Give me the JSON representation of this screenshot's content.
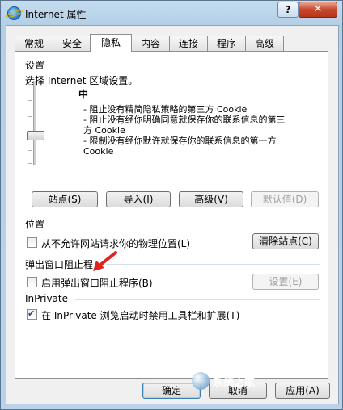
{
  "window": {
    "title": "Internet 属性",
    "help_label": "?",
    "close_label": "✕"
  },
  "tabs": [
    "常规",
    "安全",
    "隐私",
    "内容",
    "连接",
    "程序",
    "高级"
  ],
  "active_tab": "隐私",
  "settings": {
    "heading": "设置",
    "instruction": "选择 Internet 区域设置。",
    "level": "中",
    "level_position_fraction": 0.5,
    "description_lines": [
      "- 阻止没有精简隐私策略的第三方 Cookie",
      "- 阻止没有经你明确同意就保存你的联系信息的第三",
      "方 Cookie",
      "- 限制没有经你默许就保存你的联系信息的第一方",
      "Cookie"
    ],
    "buttons": {
      "sites": "站点(S)",
      "import": "导入(I)",
      "advanced": "高级(V)",
      "default": "默认值(D)"
    }
  },
  "location": {
    "heading": "位置",
    "checkbox_label": "从不允许网站请求你的物理位置(L)",
    "checked": false,
    "clear_sites": "清除站点(C)"
  },
  "popup": {
    "heading": "弹出窗口阻止程",
    "checkbox_label": "启用弹出窗口阻止程序(B)",
    "checked": false,
    "settings_button": "设置(E)"
  },
  "inprivate": {
    "heading": "InPrivate",
    "checkbox_label": "在 InPrivate 浏览启动时禁用工具栏和扩展(T)",
    "checked": true
  },
  "footer": {
    "ok": "确定",
    "cancel": "取消",
    "apply": "应用(A)"
  },
  "watermark": {
    "text": "系统之家"
  },
  "colors": {
    "arrow": "#e0231c",
    "title_bar": "#b9d2e9",
    "close_button": "#c7472c"
  }
}
